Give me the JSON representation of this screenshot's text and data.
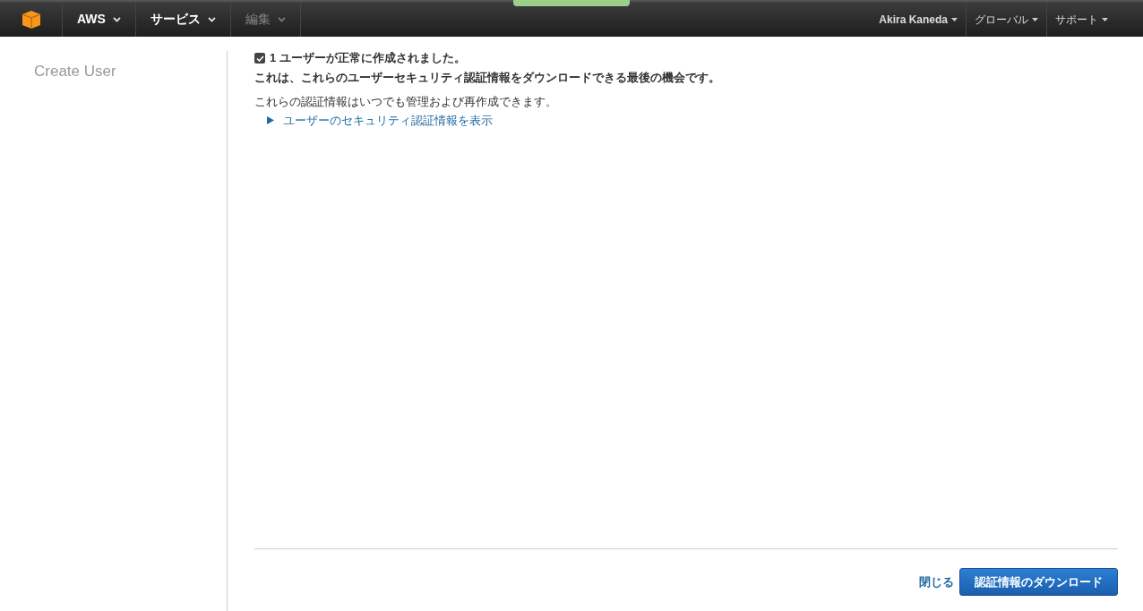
{
  "nav": {
    "left": [
      {
        "label": "AWS",
        "disabled": false
      },
      {
        "label": "サービス",
        "disabled": false
      },
      {
        "label": "編集",
        "disabled": true
      }
    ],
    "right": [
      {
        "label": "Akira Kaneda"
      },
      {
        "label": "グローバル"
      },
      {
        "label": "サポート"
      }
    ]
  },
  "sidebar": {
    "title": "Create User"
  },
  "content": {
    "success": {
      "checked": true,
      "text": "1 ユーザーが正常に作成されました。"
    },
    "warning": "これは、これらのユーザーセキュリティ認証情報をダウンロードできる最後の機会です。",
    "note": "これらの認証情報はいつでも管理および再作成できます。",
    "toggle": {
      "label": "ユーザーのセキュリティ認証情報を表示",
      "expanded": false
    }
  },
  "footer": {
    "close": "閉じる",
    "download": "認証情報のダウンロード"
  }
}
